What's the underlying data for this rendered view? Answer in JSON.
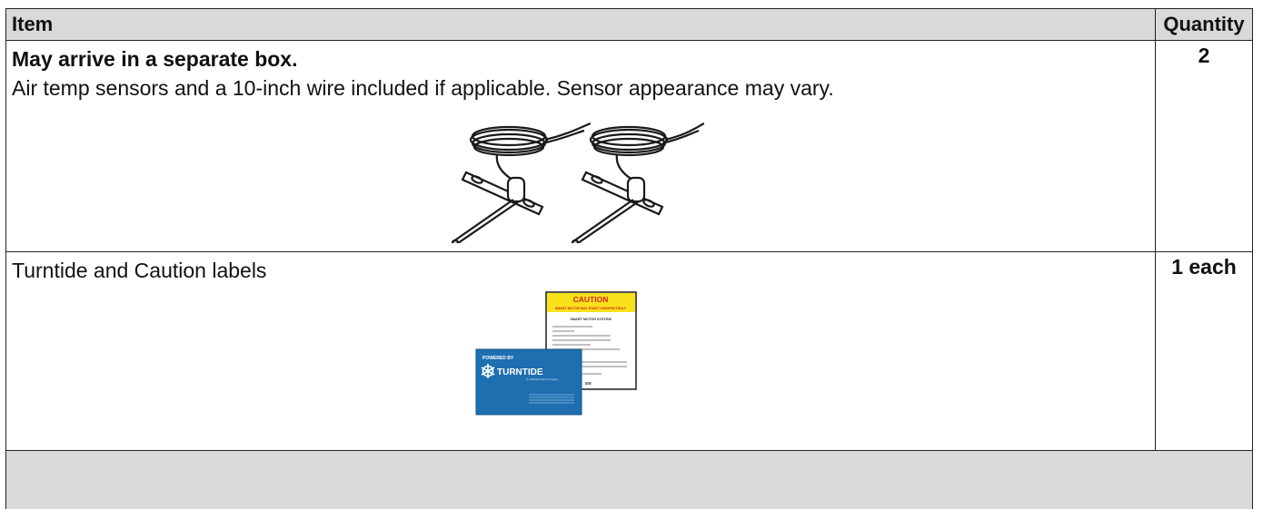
{
  "table": {
    "header": {
      "item": "Item",
      "quantity": "Quantity"
    },
    "rows": [
      {
        "title": "May arrive in a separate box.",
        "description": "Air temp sensors and a 10-inch wire included if applicable. Sensor appearance may vary.",
        "quantity": "2",
        "image": "air-temp-sensor-pair"
      },
      {
        "description": "Turntide and Caution labels",
        "quantity": "1 each",
        "image": "turntide-and-caution-labels"
      }
    ]
  },
  "caution_label": {
    "heading": "CAUTION",
    "subheading": "SMART MOTOR MAY START UNEXPECTEDLY",
    "title": "SMART MOTOR SYSTEM",
    "fragment": "IDE",
    "color": "#f7e21a",
    "heading_color": "#d6262b"
  },
  "turntide_label": {
    "top": "POWERED BY",
    "brand": "TURNTIDE",
    "sub": "by Software Motor Company",
    "color": "#1e6fb0"
  },
  "colors": {
    "header_bg": "#d9d9d9",
    "border": "#222222"
  }
}
